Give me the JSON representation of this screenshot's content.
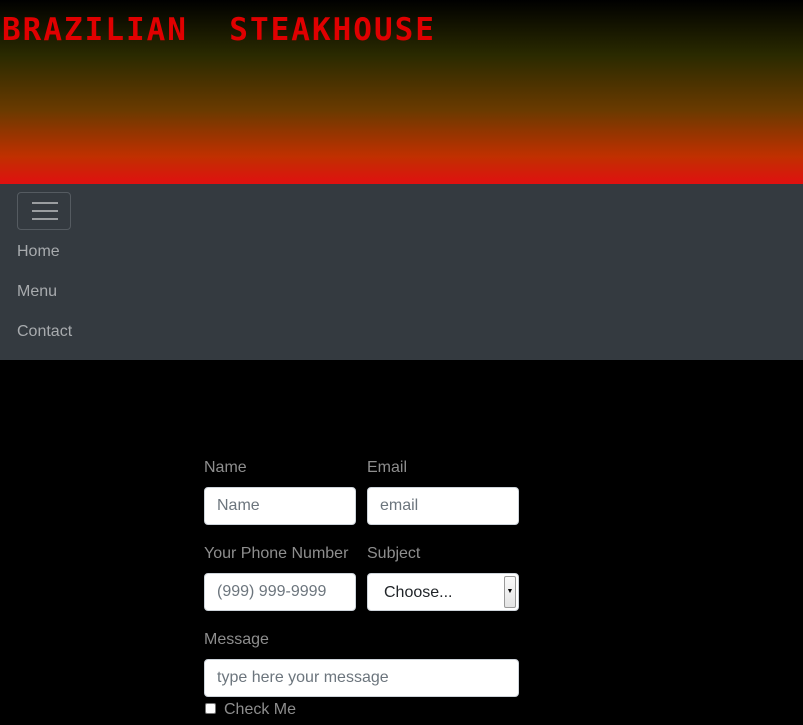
{
  "header": {
    "brand": "BRAZILIAN  STEAKHOUSE"
  },
  "navbar": {
    "toggler_icon": "hamburger-icon",
    "links": [
      {
        "label": "Home"
      },
      {
        "label": "Menu"
      },
      {
        "label": "Contact"
      }
    ]
  },
  "form": {
    "name": {
      "label": "Name",
      "placeholder": "Name"
    },
    "email": {
      "label": "Email",
      "placeholder": "email"
    },
    "phone": {
      "label": "Your Phone Number",
      "placeholder": "(999) 999-9999"
    },
    "subject": {
      "label": "Subject",
      "selected": "Choose..."
    },
    "message": {
      "label": "Message",
      "placeholder": "type here your message"
    },
    "check": {
      "label": "Check Me",
      "checked": false
    }
  },
  "colors": {
    "brand_red": "#e00000",
    "navbar_bg": "#343a40",
    "page_bg": "#000000"
  }
}
